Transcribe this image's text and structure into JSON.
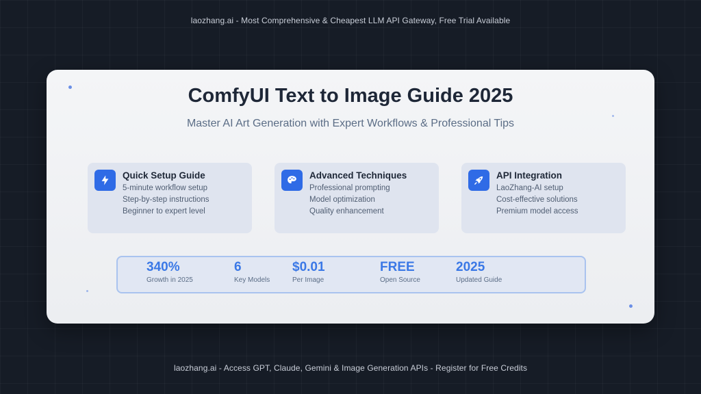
{
  "banner_top": "laozhang.ai - Most Comprehensive & Cheapest LLM API Gateway, Free Trial Available",
  "banner_bottom": "laozhang.ai - Access GPT, Claude, Gemini & Image Generation APIs - Register for Free Credits",
  "card": {
    "title": "ComfyUI Text to Image Guide 2025",
    "subtitle": "Master AI Art Generation with Expert Workflows & Professional Tips"
  },
  "features": [
    {
      "icon": "lightning-icon",
      "title": "Quick Setup Guide",
      "lines": [
        "5-minute workflow setup",
        "Step-by-step instructions",
        "Beginner to expert level"
      ]
    },
    {
      "icon": "palette-icon",
      "title": "Advanced Techniques",
      "lines": [
        "Professional prompting",
        "Model optimization",
        "Quality enhancement"
      ]
    },
    {
      "icon": "rocket-icon",
      "title": "API Integration",
      "lines": [
        "LaoZhang-AI setup",
        "Cost-effective solutions",
        "Premium model access"
      ]
    }
  ],
  "stats": [
    {
      "value": "340%",
      "label": "Growth in 2025"
    },
    {
      "value": "6",
      "label": "Key Models"
    },
    {
      "value": "$0.01",
      "label": "Per Image"
    },
    {
      "value": "FREE",
      "label": "Open Source"
    },
    {
      "value": "2025",
      "label": "Updated Guide"
    }
  ],
  "colors": {
    "background": "#161c26",
    "card": "#f0f2f4",
    "accent": "#3a78e6",
    "icon_bg": "#2f6be6",
    "title": "#1e2737"
  }
}
